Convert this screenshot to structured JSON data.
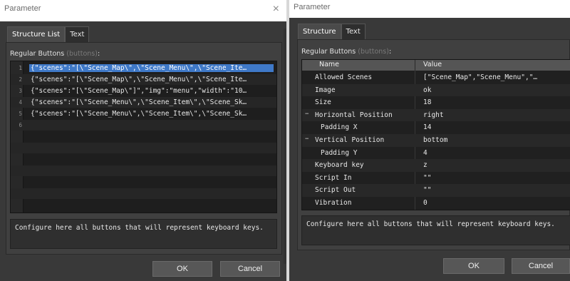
{
  "left": {
    "title": "Parameter",
    "close_glyph": "×",
    "tabs": [
      "Structure List",
      "Text"
    ],
    "section_label": "Regular Buttons",
    "section_sub": "(buttons)",
    "colon": ":",
    "rows": [
      {
        "num": "1",
        "code": "{\"scenes\":\"[\\\"Scene_Map\\\",\\\"Scene_Menu\\\",\\\"Scene_Ite…"
      },
      {
        "num": "2",
        "code": "{\"scenes\":\"[\\\"Scene_Map\\\",\\\"Scene_Menu\\\",\\\"Scene_Ite…"
      },
      {
        "num": "3",
        "code": "{\"scenes\":\"[\\\"Scene_Map\\\"]\",\"img\":\"menu\",\"width\":\"10…"
      },
      {
        "num": "4",
        "code": "{\"scenes\":\"[\\\"Scene_Menu\\\",\\\"Scene_Item\\\",\\\"Scene_Sk…"
      },
      {
        "num": "5",
        "code": "{\"scenes\":\"[\\\"Scene_Menu\\\",\\\"Scene_Item\\\",\\\"Scene_Sk…"
      },
      {
        "num": "6",
        "code": ""
      }
    ],
    "description": "Configure here all buttons that will represent keyboard keys.",
    "ok_label": "OK",
    "cancel_label": "Cancel"
  },
  "right": {
    "title": "Parameter",
    "tabs": [
      "Structure",
      "Text"
    ],
    "section_label": "Regular Buttons",
    "section_sub": "(buttons)",
    "colon": ":",
    "columns": [
      "Name",
      "Value"
    ],
    "rows": [
      {
        "name": "Allowed Scenes",
        "value": "[\"Scene_Map\",\"Scene_Menu\",\"…",
        "indent": 1,
        "expander": ""
      },
      {
        "name": "Image",
        "value": "ok",
        "indent": 1,
        "expander": ""
      },
      {
        "name": "Size",
        "value": "18",
        "indent": 1,
        "expander": ""
      },
      {
        "name": "Horizontal Position",
        "value": "right",
        "indent": 1,
        "expander": "−"
      },
      {
        "name": "Padding X",
        "value": "14",
        "indent": 2,
        "expander": ""
      },
      {
        "name": "Vertical Position",
        "value": "bottom",
        "indent": 1,
        "expander": "−"
      },
      {
        "name": "Padding Y",
        "value": "4",
        "indent": 2,
        "expander": ""
      },
      {
        "name": "Keyboard key",
        "value": "z",
        "indent": 1,
        "expander": ""
      },
      {
        "name": "Script In",
        "value": "\"\"",
        "indent": 1,
        "expander": ""
      },
      {
        "name": "Script Out",
        "value": "\"\"",
        "indent": 1,
        "expander": ""
      },
      {
        "name": "Vibration",
        "value": "0",
        "indent": 1,
        "expander": ""
      }
    ],
    "description": "Configure here all buttons that will represent keyboard keys.",
    "ok_label": "OK",
    "cancel_label": "Cancel"
  },
  "colors": {
    "selection": "#3f79c8",
    "dialog_bg": "#393939",
    "list_bg": "#1e1e1e"
  }
}
